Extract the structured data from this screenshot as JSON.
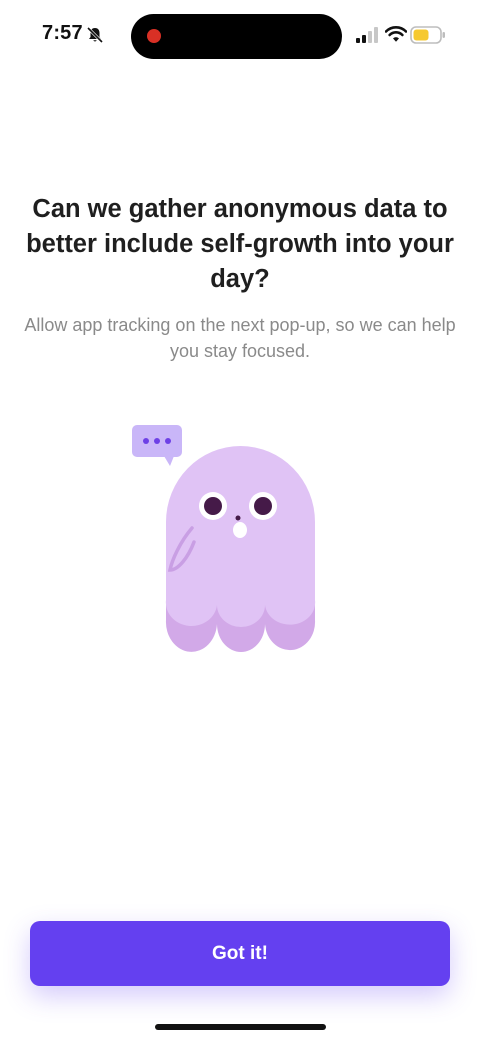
{
  "status_bar": {
    "time": "7:57",
    "icons": [
      "bell-slash-icon",
      "recording-dot-icon",
      "cellular-signal-icon",
      "wifi-icon",
      "battery-icon"
    ],
    "battery_color": "#f6c930",
    "recording_color": "#d93025"
  },
  "content": {
    "title": "Can we gather anonymous data to better include self-growth into your day?",
    "subtitle": "Allow app tracking on the next pop-up, so we can help you stay focused."
  },
  "illustration": {
    "name": "ghost-illustration",
    "colors": {
      "ghost_body": "#e0c3f5",
      "ghost_base": "#d2a9e8",
      "speech_bubble": "#c9b6f8",
      "speech_dots": "#6d40e6",
      "eyes": "#451a48"
    }
  },
  "actions": {
    "primary_label": "Got it!",
    "primary_color": "#6440f0"
  }
}
